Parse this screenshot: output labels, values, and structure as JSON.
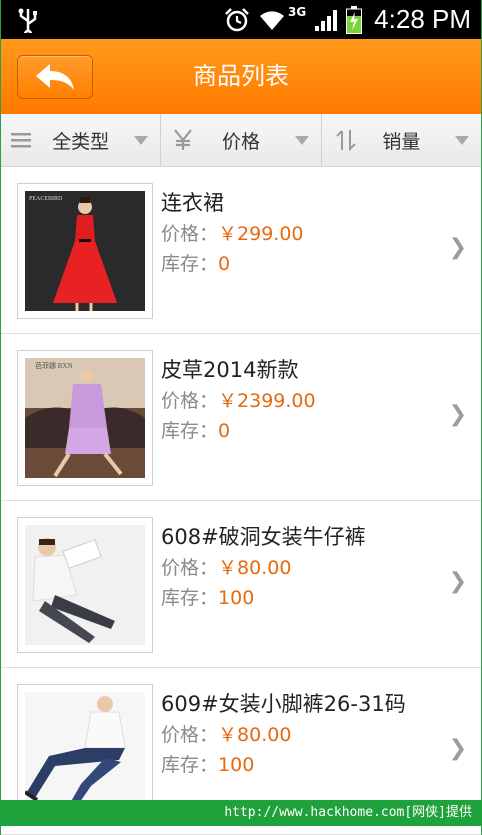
{
  "status_bar": {
    "time": "4:28 PM",
    "network": "3G",
    "icons": [
      "usb-icon",
      "alarm-icon",
      "wifi-icon",
      "signal-icon",
      "battery-charging-icon"
    ]
  },
  "header": {
    "title": "商品列表",
    "back_icon": "back-arrow-icon"
  },
  "filters": [
    {
      "label": "全类型",
      "icon": "menu-lines-icon"
    },
    {
      "label": "价格",
      "icon": "yen-icon"
    },
    {
      "label": "销量",
      "icon": "sort-arrows-icon"
    }
  ],
  "products": [
    {
      "name": "连衣裙",
      "price_label": "价格：",
      "price": "￥299.00",
      "stock_label": "库存：",
      "stock": "0",
      "thumb_logo": "PEACEBIRD"
    },
    {
      "name": "皮草2014新款",
      "price_label": "价格：",
      "price": "￥2399.00",
      "stock_label": "库存：",
      "stock": "0",
      "thumb_logo": "芭菲娜 BXN"
    },
    {
      "name": "608#破洞女装牛仔裤",
      "price_label": "价格：",
      "price": "￥80.00",
      "stock_label": "库存：",
      "stock": "100",
      "thumb_logo": ""
    },
    {
      "name": "609#女装小脚裤26-31码",
      "price_label": "价格：",
      "price": "￥80.00",
      "stock_label": "库存：",
      "stock": "100",
      "thumb_logo": ""
    }
  ],
  "watermark": "http://www.hackhome.com[网侠]提供",
  "colors": {
    "header": "#ff8200",
    "price": "#e56a10",
    "watermark_bg": "#1fa23c"
  }
}
